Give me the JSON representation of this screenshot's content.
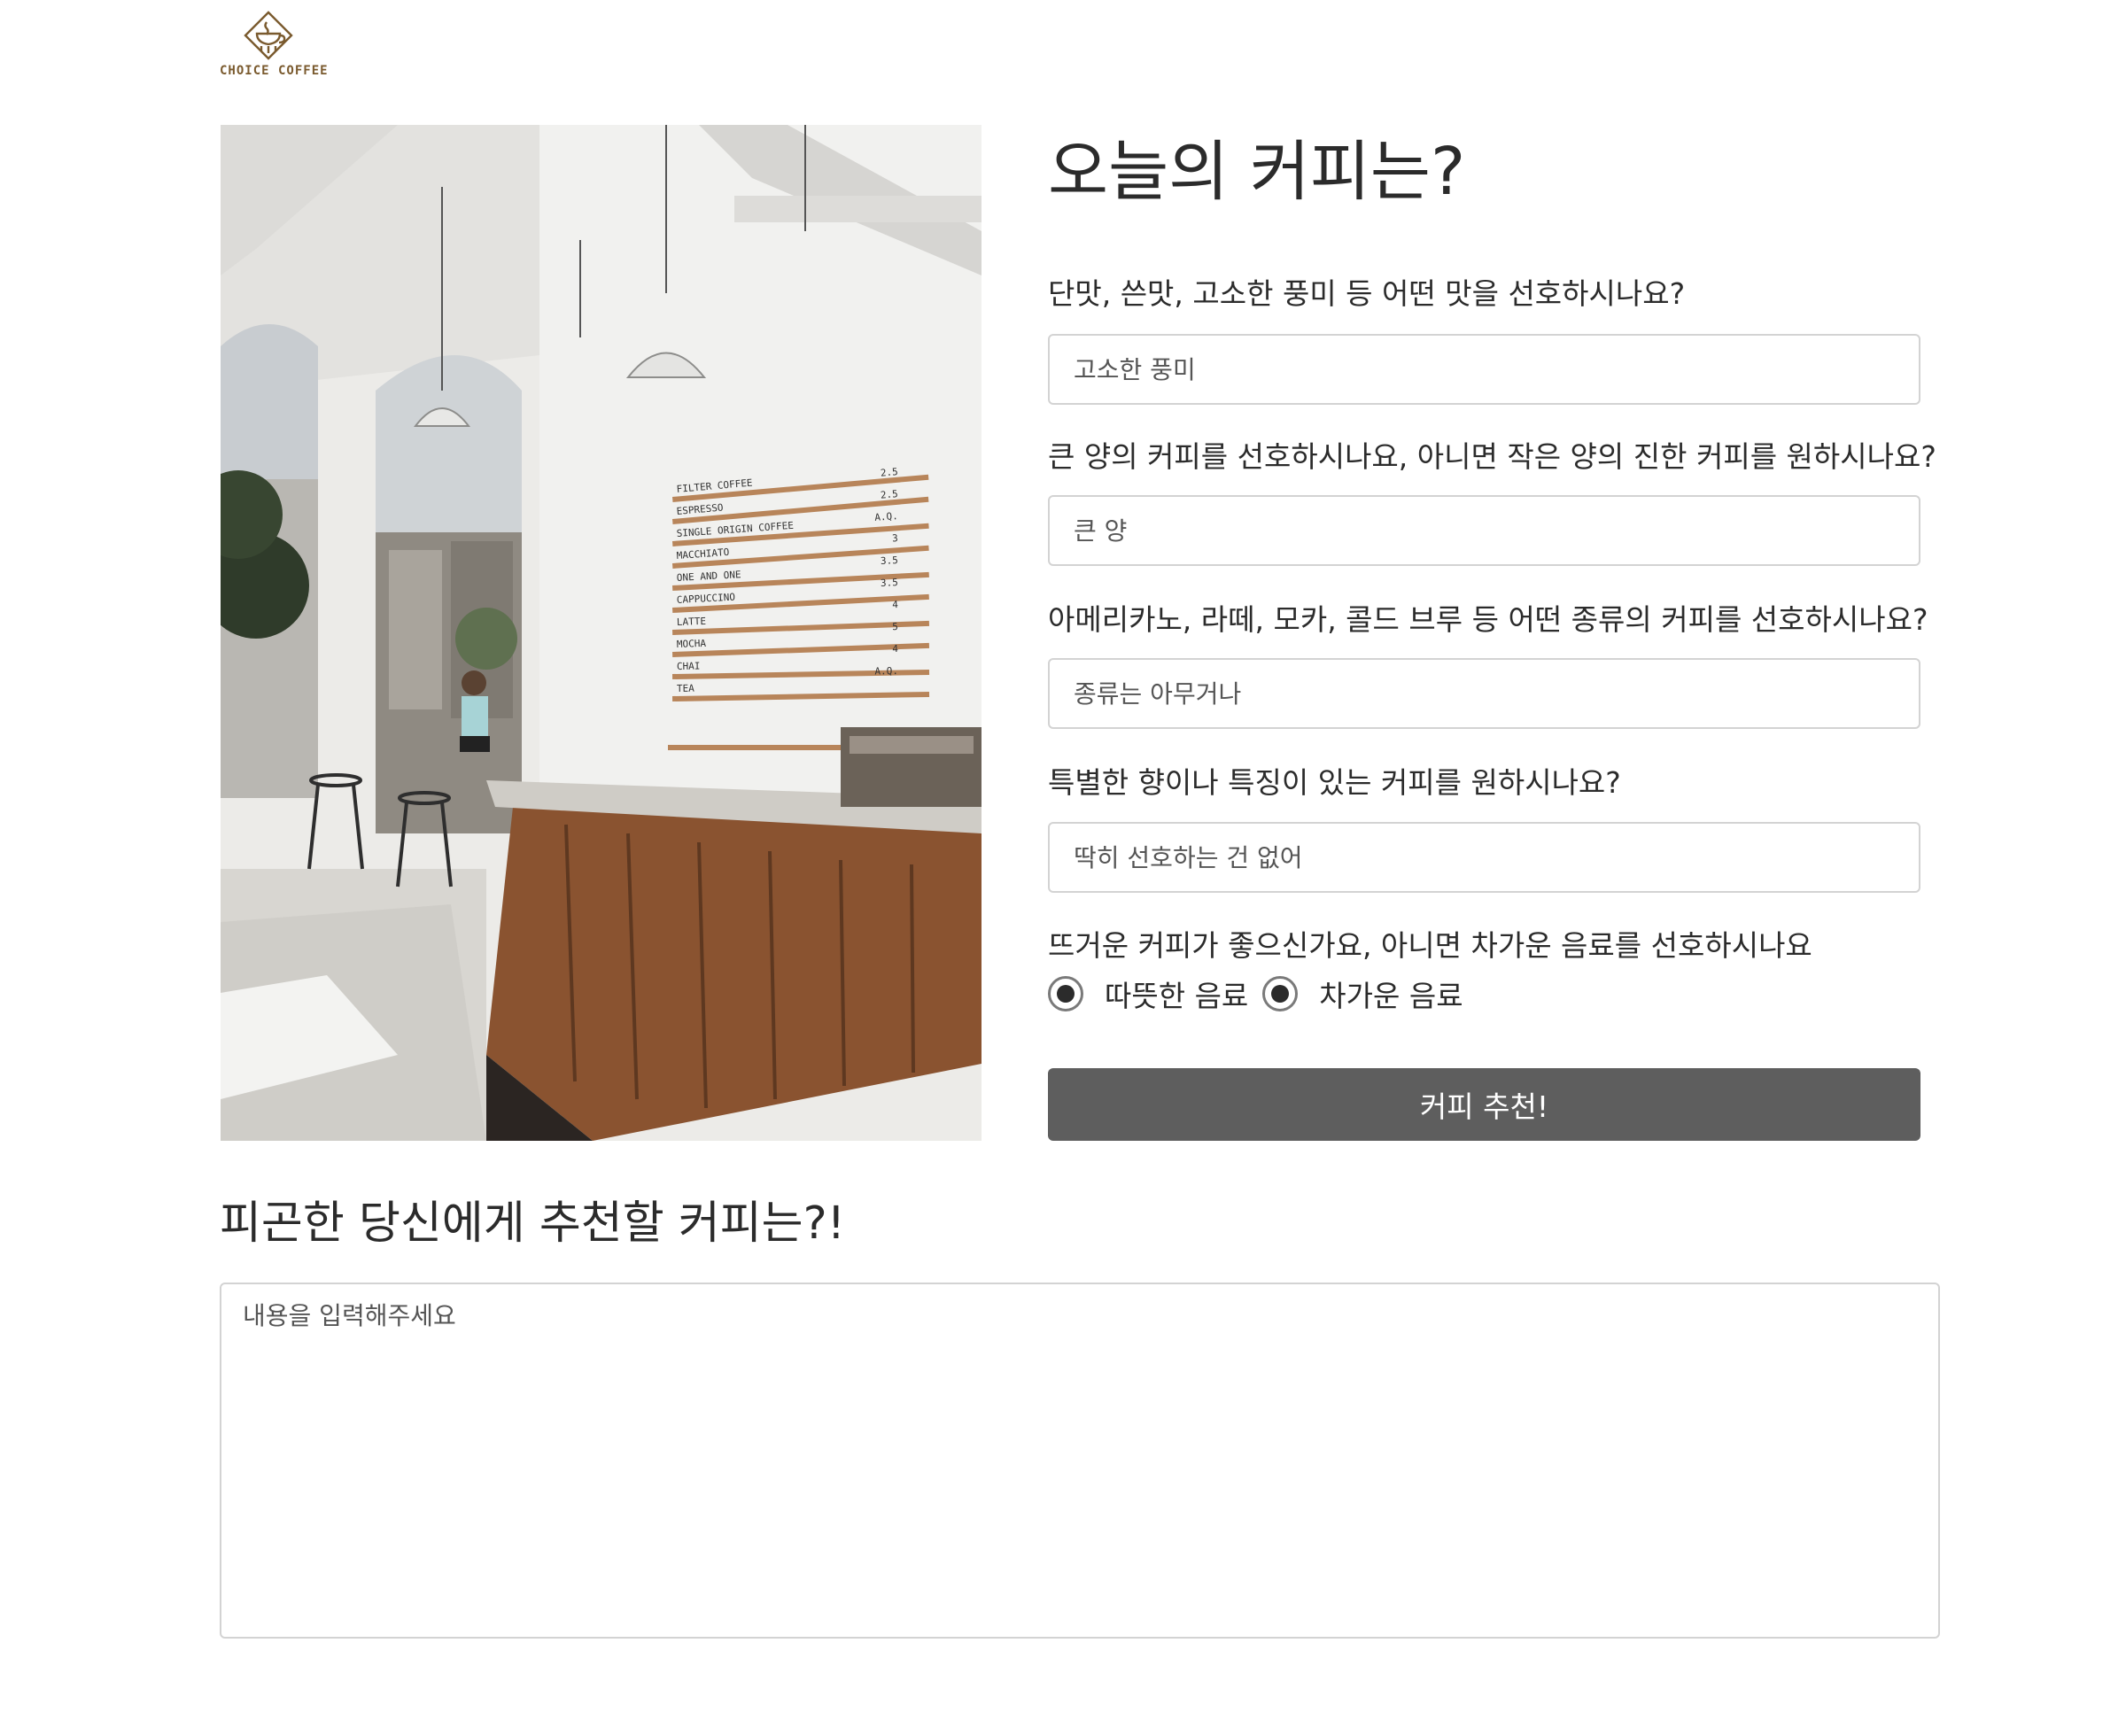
{
  "header": {
    "logo_text": "CHOICE COFFEE"
  },
  "hero": {
    "menu_board": [
      {
        "item": "FILTER COFFEE",
        "price": "2.5"
      },
      {
        "item": "ESPRESSO",
        "price": "2.5"
      },
      {
        "item": "SINGLE ORIGIN COFFEE",
        "price": "A.Q."
      },
      {
        "item": "MACCHIATO",
        "price": "3"
      },
      {
        "item": "ONE AND ONE",
        "price": "3.5"
      },
      {
        "item": "CAPPUCCINO",
        "price": "3.5"
      },
      {
        "item": "LATTE",
        "price": "4"
      },
      {
        "item": "MOCHA",
        "price": "5"
      },
      {
        "item": "CHAI",
        "price": "4"
      },
      {
        "item": "TEA",
        "price": "A.Q."
      }
    ]
  },
  "form": {
    "title": "오늘의 커피는?",
    "questions": [
      {
        "label": "단맛, 쓴맛, 고소한 풍미 등 어떤 맛을 선호하시나요?",
        "placeholder": "고소한 풍미"
      },
      {
        "label": "큰 양의 커피를 선호하시나요, 아니면 작은 양의 진한 커피를 원하시나요?",
        "placeholder": "큰 양"
      },
      {
        "label": "아메리카노, 라떼, 모카, 콜드 브루 등 어떤 종류의 커피를 선호하시나요?",
        "placeholder": "종류는 아무거나"
      },
      {
        "label": "특별한 향이나 특징이 있는 커피를 원하시나요?",
        "placeholder": "딱히 선호하는 건 없어"
      }
    ],
    "temperature": {
      "label": "뜨거운 커피가 좋으신가요, 아니면 차가운 음료를 선호하시나요",
      "options": [
        "따뜻한 음료",
        "차가운 음료"
      ]
    },
    "submit_label": "커피 추천!"
  },
  "result": {
    "heading": "피곤한 당신에게 추천할 커피는?!",
    "placeholder": "내용을 입력해주세요"
  }
}
